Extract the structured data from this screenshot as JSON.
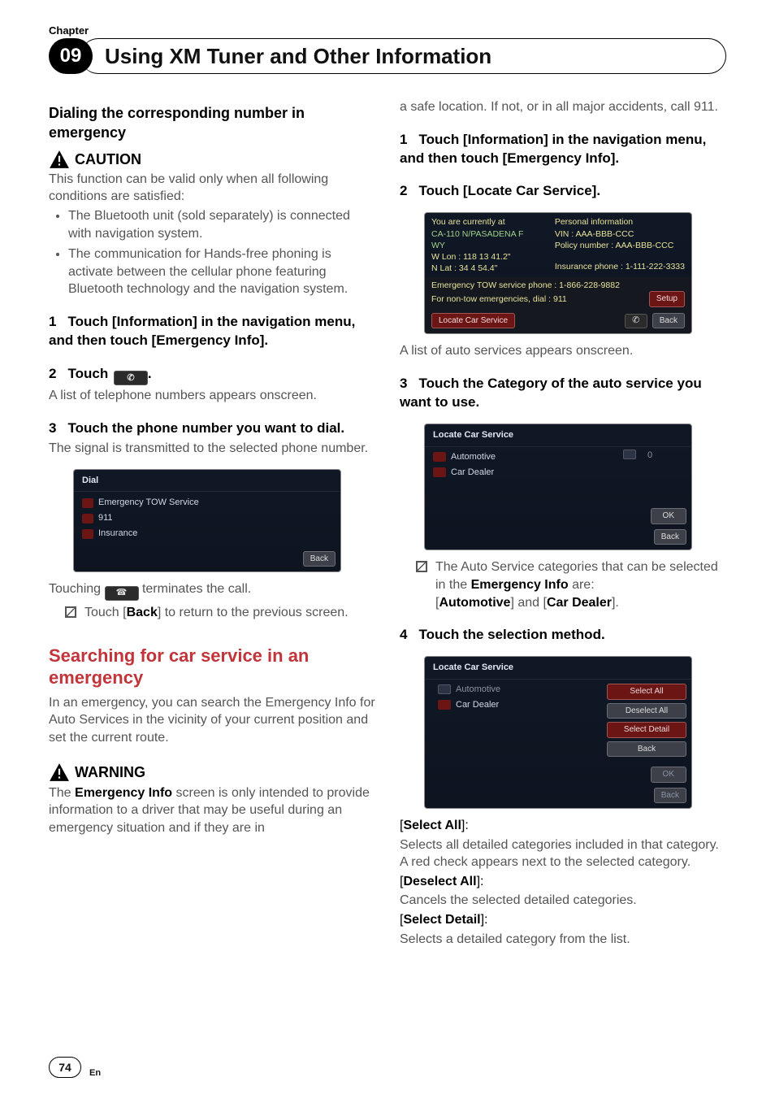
{
  "header": {
    "chapter_label": "Chapter",
    "chapter_number": "09",
    "title": "Using XM Tuner and Other Information"
  },
  "col_left": {
    "subsection_dial": "Dialing the corresponding number in emergency",
    "caution_label": "CAUTION",
    "caution_intro": "This function can be valid only when all following conditions are satisfied:",
    "bullets": [
      "The Bluetooth unit (sold separately) is connected with navigation system.",
      "The communication for Hands-free phoning is activate between the cellular phone featuring Bluetooth technology and the navigation system."
    ],
    "step1": {
      "num": "1",
      "text_a": "Touch [Information] in the navigation menu, and then touch [Emergency Info]."
    },
    "step2": {
      "num": "2",
      "text_a": "Touch ",
      "text_b": "."
    },
    "after_step2": "A list of telephone numbers appears onscreen.",
    "step3": {
      "num": "3",
      "text": "Touch the phone number you want to dial."
    },
    "after_step3": "The signal is transmitted to the selected phone number.",
    "ss_dial": {
      "title": "Dial",
      "items": [
        "Emergency TOW Service",
        "911",
        "Insurance"
      ],
      "back": "Back"
    },
    "touching_a": "Touching ",
    "touching_b": " terminates the call.",
    "note_back_a": "Touch [",
    "note_back_b": "Back",
    "note_back_c": "] to return to the previous screen.",
    "h2": "Searching for car service in an emergency",
    "search_intro": "In an emergency, you can search the Emergency Info for Auto Services in the vicinity of your current position and set the current route.",
    "warning_label": "WARNING",
    "warning_a": "The ",
    "warning_b": "Emergency Info",
    "warning_c": " screen is only intended to provide information to a driver that may be useful during an emergency situation and if they are in"
  },
  "col_right": {
    "continuation": "a safe location. If not, or in all major accidents, call 911.",
    "step1": {
      "num": "1",
      "text": "Touch [Information] in the navigation menu, and then touch [Emergency Info]."
    },
    "step2": {
      "num": "2",
      "text": "Touch [Locate Car Service]."
    },
    "ss_info": {
      "left": [
        "You are currently at",
        "CA-110 N/PASADENA F",
        "WY",
        "W Lon : 118 13 41.2\"",
        "N Lat : 34 4 54.4\""
      ],
      "right_label": "Personal information",
      "right": [
        "VIN : AAA-BBB-CCC",
        "Policy number : AAA-BBB-CCC",
        "Insurance phone : 1-111-222-3333"
      ],
      "tow": "Emergency TOW service phone : 1-866-228-9882",
      "nontow": "For non-tow emergencies, dial : 911",
      "setup": "Setup",
      "locate": "Locate Car Service",
      "back": "Back"
    },
    "after_ss_info": "A list of auto services appears onscreen.",
    "step3": {
      "num": "3",
      "text": "Touch the Category of the auto service you want to use."
    },
    "ss_locate1": {
      "title": "Locate Car Service",
      "items": [
        "Automotive",
        "Car Dealer"
      ],
      "count": "0",
      "ok": "OK",
      "back": "Back"
    },
    "note_cat_a": "The Auto Service categories that can be selected in the ",
    "note_cat_b": "Emergency Info",
    "note_cat_c": " are:",
    "note_cat_line2_a": "[",
    "note_cat_line2_b": "Automotive",
    "note_cat_line2_c": "] and [",
    "note_cat_line2_d": "Car Dealer",
    "note_cat_line2_e": "].",
    "step4": {
      "num": "4",
      "text": "Touch the selection method."
    },
    "ss_locate2": {
      "title": "Locate Car Service",
      "items": [
        "Automotive",
        "Car Dealer"
      ],
      "btns": [
        "Select All",
        "Deselect All",
        "Select Detail",
        "Back"
      ],
      "ok": "OK",
      "back2": "Back"
    },
    "defs": {
      "sel_all_label": "Select All",
      "sel_all_text": "Selects all detailed categories included in that category. A red check appears next to the selected category.",
      "desel_all_label": "Deselect All",
      "desel_all_text": "Cancels the selected detailed categories.",
      "sel_detail_label": "Select Detail",
      "sel_detail_text": "Selects a detailed category from the list."
    }
  },
  "footer": {
    "page": "74",
    "lang": "En"
  }
}
